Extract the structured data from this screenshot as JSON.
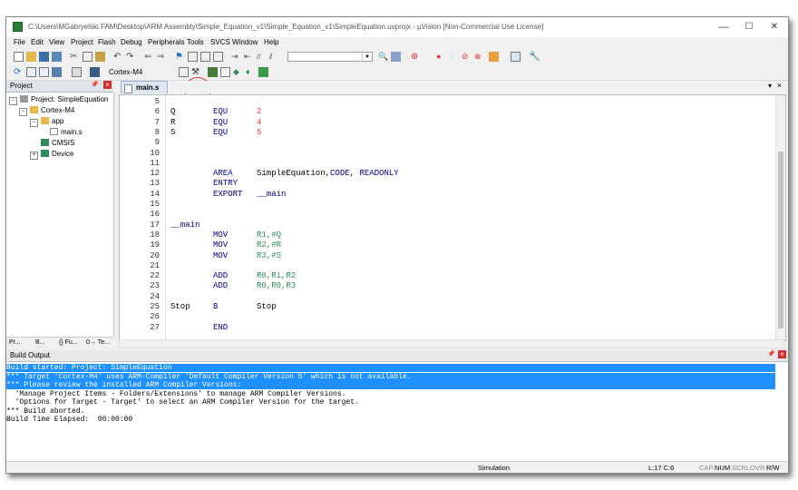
{
  "window": {
    "title": "C:\\Users\\MGabryelski.FAM\\Desktop\\ARM Assembly\\Simple_Equation_v1\\Simple_Equation_v1\\SimpleEquation.uvprojx - µVision  [Non-Commercial Use License]",
    "minimize": "—",
    "maximize": "☐",
    "close": "✕"
  },
  "menu": [
    "File",
    "Edit",
    "View",
    "Project",
    "Flash",
    "Debug",
    "Peripherals",
    "Tools",
    "SVCS",
    "Window",
    "Help"
  ],
  "toolbar": {
    "target_select": "Cortex-M4"
  },
  "project_panel": {
    "title": "Project",
    "pin": "p",
    "close": "×",
    "tree": {
      "root": "Project: SimpleEquation",
      "target": "Cortex-M4",
      "group": "app",
      "file": "main.s",
      "cmsis": "CMSIS",
      "device": "Device"
    },
    "bottom_tabs": [
      "Pr...",
      "B...",
      "{} Fu...",
      "0→ Te..."
    ]
  },
  "editor": {
    "tab": "main.s",
    "lines": [
      {
        "n": "5",
        "c1": "",
        "c2": "",
        "c3": ""
      },
      {
        "n": "6",
        "c1": "Q",
        "c2": "EQU",
        "c3": "2"
      },
      {
        "n": "7",
        "c1": "R",
        "c2": "EQU",
        "c3": "4"
      },
      {
        "n": "8",
        "c1": "S",
        "c2": "EQU",
        "c3": "5"
      },
      {
        "n": "9",
        "c1": "",
        "c2": "",
        "c3": ""
      },
      {
        "n": "10",
        "c1": "",
        "c2": "",
        "c3": ""
      },
      {
        "n": "11",
        "c1": "",
        "c2": "",
        "c3": ""
      },
      {
        "n": "12",
        "c1": "",
        "c2": "AREA",
        "c3": "SimpleEquation,CODE, READONLY"
      },
      {
        "n": "13",
        "c1": "",
        "c2": "ENTRY",
        "c3": ""
      },
      {
        "n": "14",
        "c1": "",
        "c2": "EXPORT",
        "c3": "__main"
      },
      {
        "n": "15",
        "c1": "",
        "c2": "",
        "c3": ""
      },
      {
        "n": "16",
        "c1": "",
        "c2": "",
        "c3": ""
      },
      {
        "n": "17",
        "c1": "__main",
        "c2": "",
        "c3": ""
      },
      {
        "n": "18",
        "c1": "",
        "c2": "MOV",
        "c3": "R1,#Q"
      },
      {
        "n": "19",
        "c1": "",
        "c2": "MOV",
        "c3": "R2,#R"
      },
      {
        "n": "20",
        "c1": "",
        "c2": "MOV",
        "c3": "R3,#S"
      },
      {
        "n": "21",
        "c1": "",
        "c2": "",
        "c3": ""
      },
      {
        "n": "22",
        "c1": "",
        "c2": "ADD",
        "c3": "R0,R1,R2"
      },
      {
        "n": "23",
        "c1": "",
        "c2": "ADD",
        "c3": "R0,R0,R3"
      },
      {
        "n": "24",
        "c1": "",
        "c2": "",
        "c3": ""
      },
      {
        "n": "25",
        "c1": "Stop",
        "c2": "B",
        "c3": "Stop"
      },
      {
        "n": "26",
        "c1": "",
        "c2": "",
        "c3": ""
      },
      {
        "n": "27",
        "c1": "",
        "c2": "END",
        "c3": ""
      }
    ]
  },
  "build_output": {
    "title": "Build Output",
    "lines": [
      {
        "text": "Build started: Project: SimpleEquation",
        "selected": true
      },
      {
        "text": "*** Target 'Cortex-M4' uses ARM-Compiler 'Default Compiler Version 5' which is not available.",
        "selected": true
      },
      {
        "text": "*** Please review the installed ARM Compiler Versions:",
        "selected": true
      },
      {
        "text": "  'Manage Project Items - Folders/Extensions' to manage ARM Compiler Versions.",
        "selected": false
      },
      {
        "text": "  'Options for Target - Target' to select an ARM Compiler Version for the target.",
        "selected": false
      },
      {
        "text": "*** Build aborted.",
        "selected": false
      },
      {
        "text": "Build Time Elapsed:  00:00:00",
        "selected": false
      }
    ]
  },
  "status": {
    "mode": "Simulation",
    "position": "L:17 C:6",
    "cap": "CAP",
    "num": "NUM",
    "scrl": "SCRL",
    "ovr": "OVR",
    "rw": "R/W"
  },
  "colors": {
    "selection": "#1e90ff",
    "keyword": "#00008b",
    "number": "#e53935",
    "string_green": "#2e8b57"
  }
}
